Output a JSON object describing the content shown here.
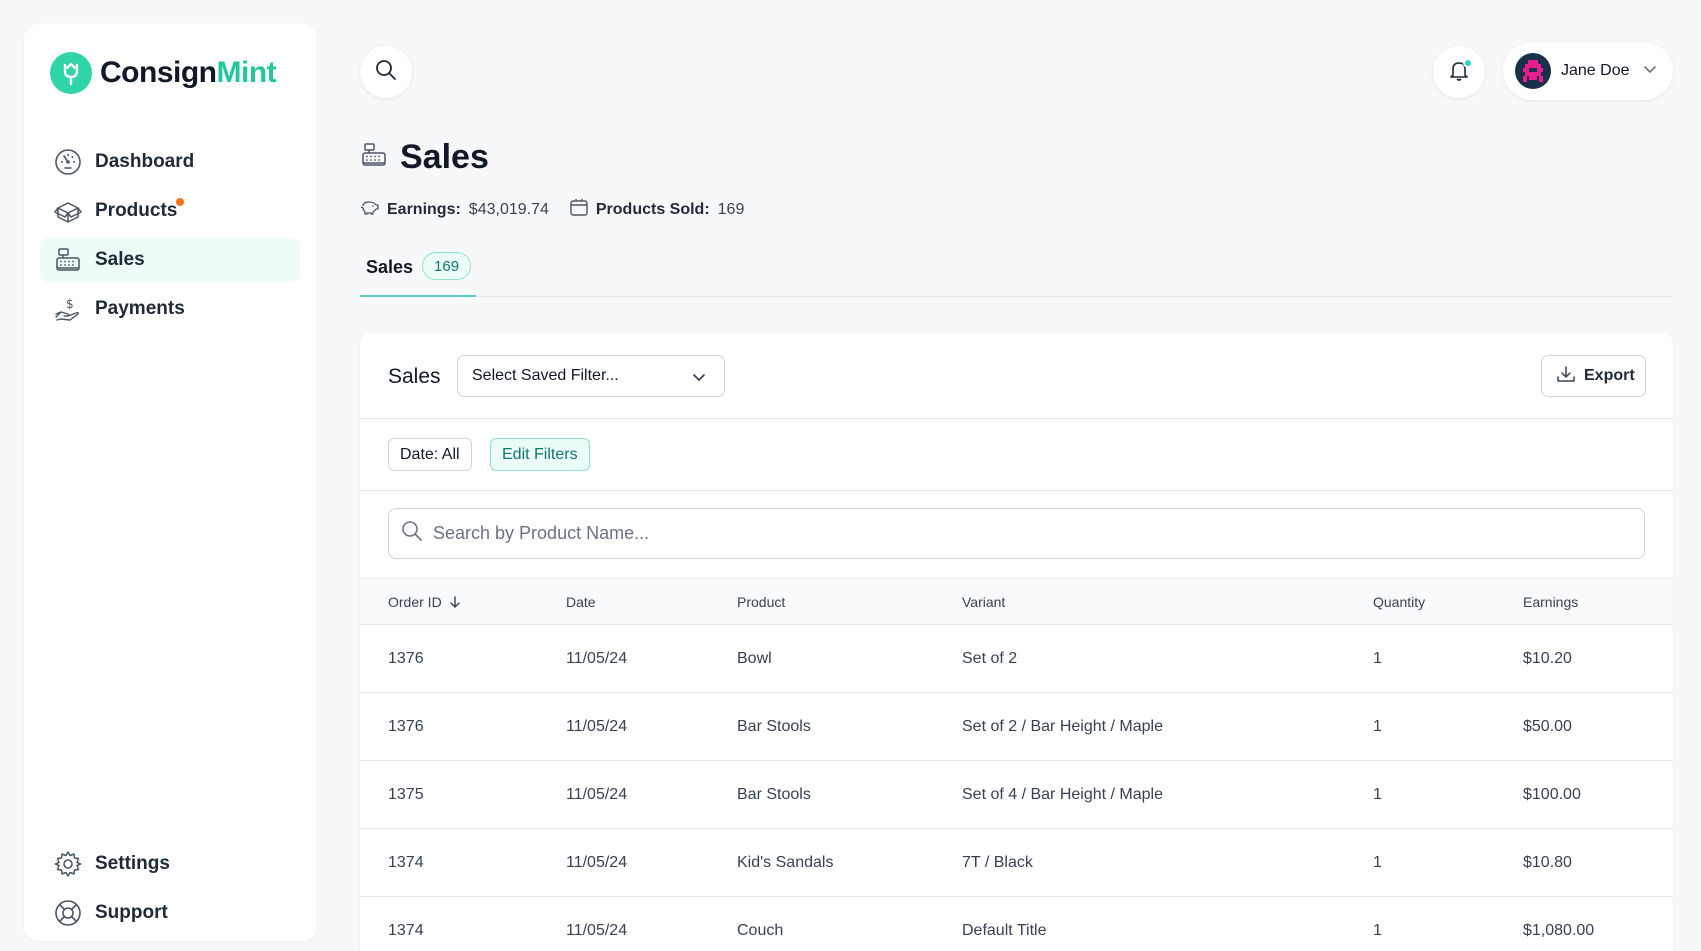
{
  "brand": {
    "name_part1": "Consign",
    "name_part2": "Mint",
    "accent": "#23c79b"
  },
  "sidebar": {
    "items": [
      {
        "label": "Dashboard",
        "icon": "dashboard-icon"
      },
      {
        "label": "Products",
        "icon": "box-icon",
        "has_notification_dot": true
      },
      {
        "label": "Sales",
        "icon": "cash-register-icon",
        "active": true
      },
      {
        "label": "Payments",
        "icon": "payment-icon"
      }
    ],
    "bottom_items": [
      {
        "label": "Settings",
        "icon": "gear-icon"
      },
      {
        "label": "Support",
        "icon": "lifebuoy-icon"
      }
    ]
  },
  "header": {
    "user_name": "Jane Doe",
    "has_notification": true
  },
  "page": {
    "title": "Sales",
    "stats": {
      "earnings_label": "Earnings:",
      "earnings_value": "$43,019.74",
      "products_sold_label": "Products Sold:",
      "products_sold_value": "169"
    },
    "tabs": [
      {
        "label": "Sales",
        "count": "169",
        "active": true
      }
    ]
  },
  "card": {
    "title": "Sales",
    "saved_filter_placeholder": "Select Saved Filter...",
    "export_label": "Export",
    "date_filter_label": "Date: All",
    "edit_filters_label": "Edit Filters",
    "search_placeholder": "Search by Product Name...",
    "search_value": ""
  },
  "table": {
    "columns": [
      "Order ID",
      "Date",
      "Product",
      "Variant",
      "Quantity",
      "Earnings"
    ],
    "sort_column": "Order ID",
    "sort_direction": "descending",
    "rows": [
      [
        "1376",
        "11/05/24",
        "Bowl",
        "Set of 2",
        "1",
        "$10.20"
      ],
      [
        "1376",
        "11/05/24",
        "Bar Stools",
        "Set of 2 / Bar Height / Maple",
        "1",
        "$50.00"
      ],
      [
        "1375",
        "11/05/24",
        "Bar Stools",
        "Set of 4 / Bar Height / Maple",
        "1",
        "$100.00"
      ],
      [
        "1374",
        "11/05/24",
        "Kid's Sandals",
        "7T / Black",
        "1",
        "$10.80"
      ],
      [
        "1374",
        "11/05/24",
        "Couch",
        "Default Title",
        "1",
        "$1,080.00"
      ]
    ]
  }
}
